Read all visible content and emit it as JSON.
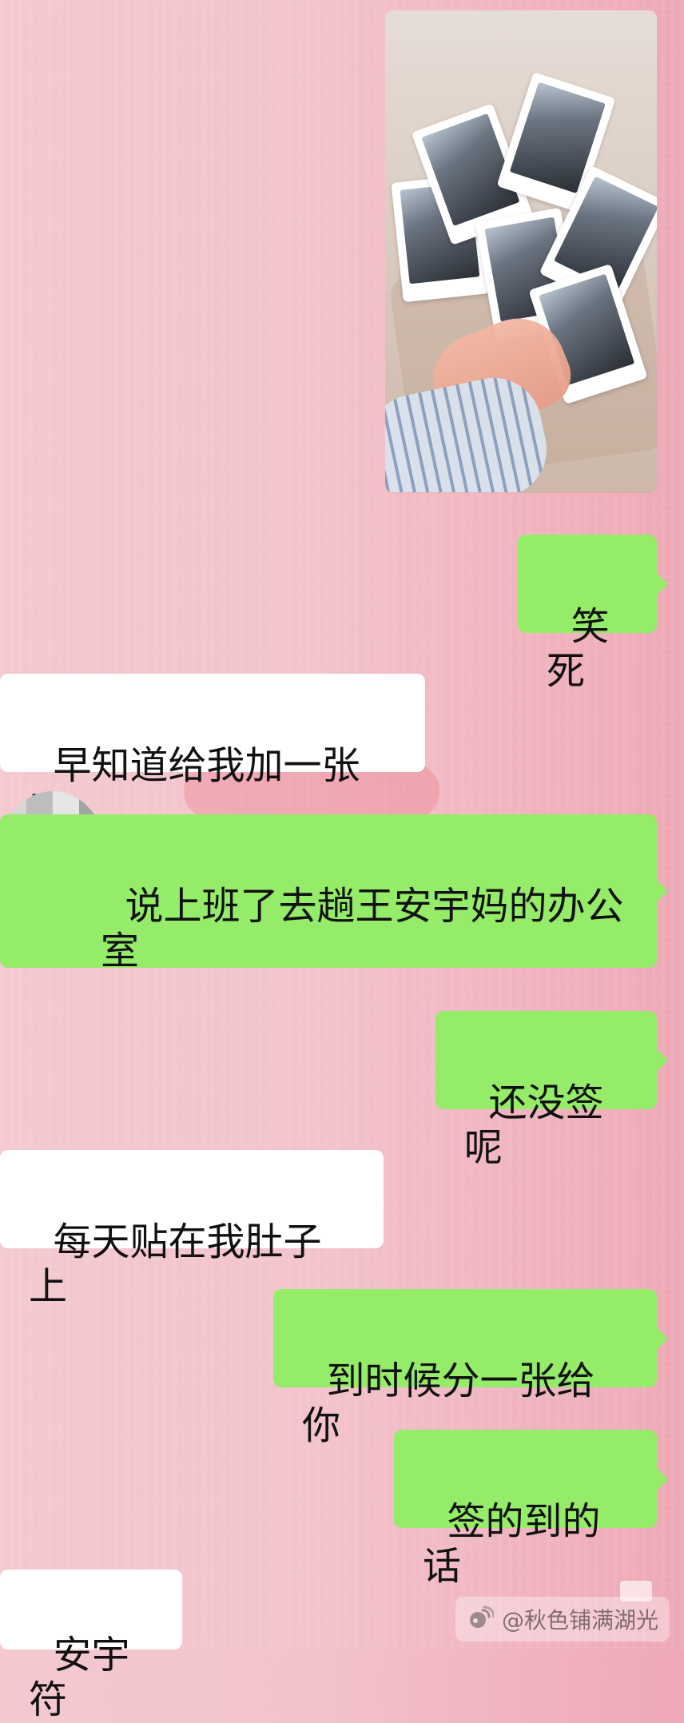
{
  "chat": {
    "messages": [
      {
        "from": "me",
        "text": "笑死"
      },
      {
        "from": "them",
        "text": "早知道给我加一张了"
      },
      {
        "from": "me",
        "text": "说上班了去趟王安宇妈的办公\n室"
      },
      {
        "from": "me",
        "text": "还没签呢"
      },
      {
        "from": "them",
        "text": "每天贴在我肚子上"
      },
      {
        "from": "me",
        "text": "到时候分一张给你"
      },
      {
        "from": "me",
        "text": "签的到的话"
      },
      {
        "from": "them",
        "text": "安宇符"
      }
    ]
  },
  "watermark": {
    "text": "@秋色铺满湖光",
    "icon": "weibo-icon"
  },
  "colors": {
    "outgoing_bubble": "#95ec69",
    "incoming_bubble": "#ffffff",
    "background": "#f3c3cb"
  }
}
